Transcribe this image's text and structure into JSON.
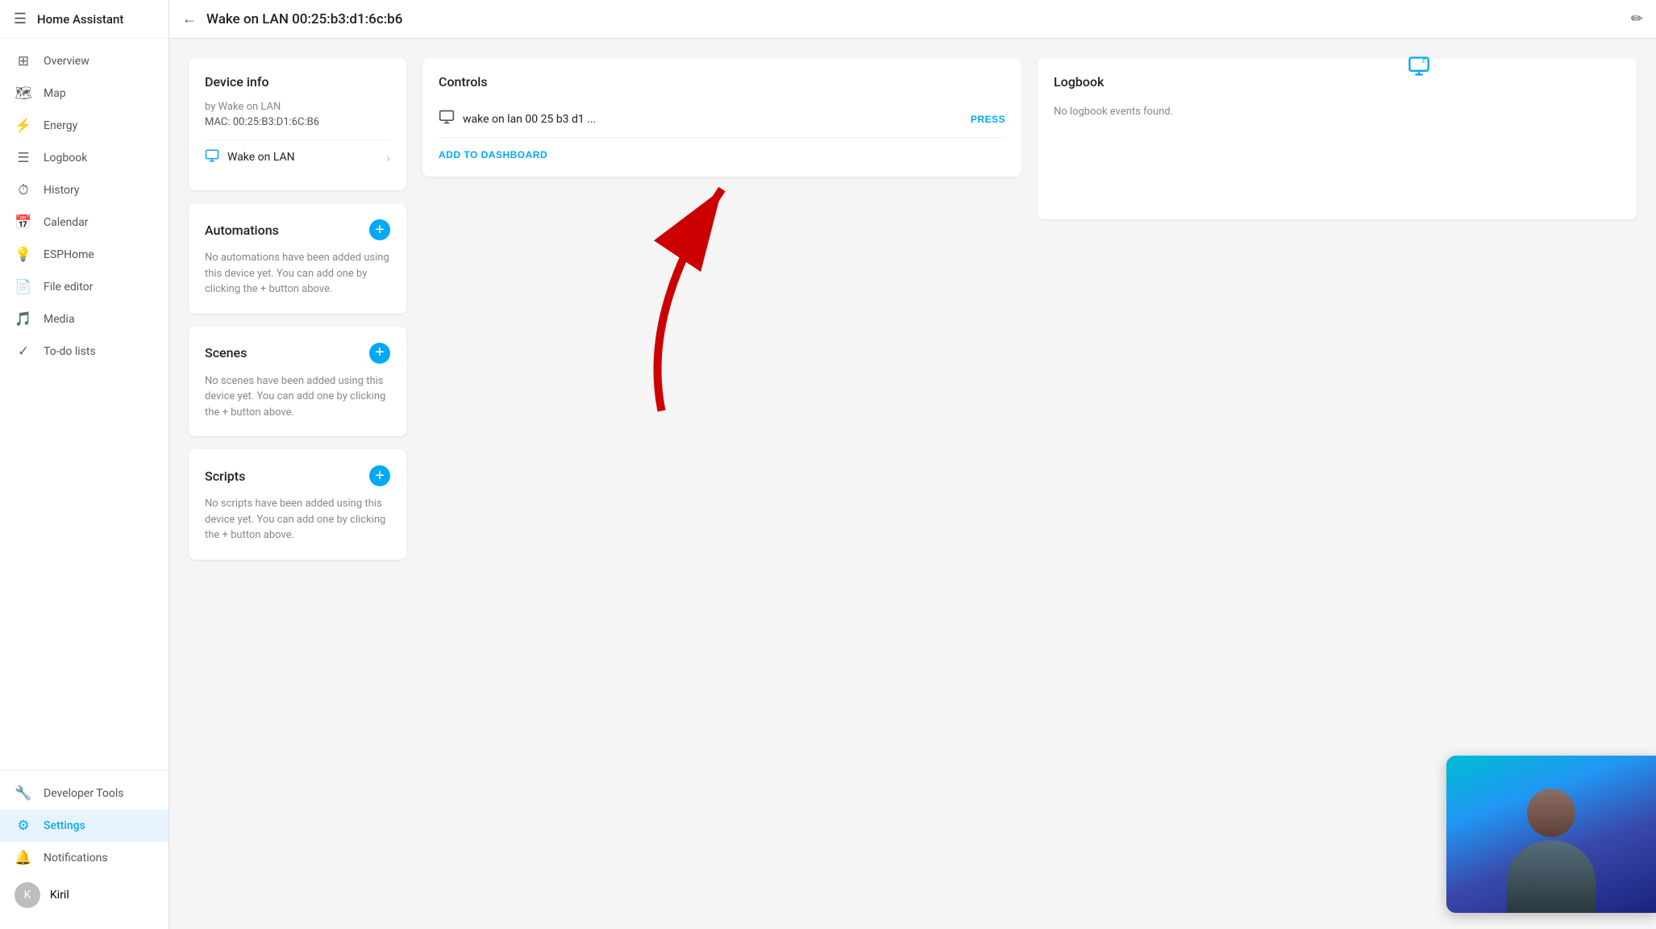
{
  "app": {
    "title": "Home Assistant"
  },
  "topbar": {
    "title": "Wake on LAN 00:25:b3:d1:6c:b6",
    "back_label": "←",
    "edit_label": "✏"
  },
  "sidebar": {
    "items": [
      {
        "id": "overview",
        "label": "Overview",
        "icon": "grid"
      },
      {
        "id": "map",
        "label": "Map",
        "icon": "map"
      },
      {
        "id": "energy",
        "label": "Energy",
        "icon": "bolt"
      },
      {
        "id": "logbook",
        "label": "Logbook",
        "icon": "list"
      },
      {
        "id": "history",
        "label": "History",
        "icon": "history"
      },
      {
        "id": "calendar",
        "label": "Calendar",
        "icon": "calendar"
      },
      {
        "id": "esphome",
        "label": "ESPHome",
        "icon": "chip"
      },
      {
        "id": "file-editor",
        "label": "File editor",
        "icon": "file"
      },
      {
        "id": "media",
        "label": "Media",
        "icon": "music"
      },
      {
        "id": "todo",
        "label": "To-do lists",
        "icon": "check"
      }
    ],
    "bottom": [
      {
        "id": "developer-tools",
        "label": "Developer Tools",
        "icon": "wrench"
      },
      {
        "id": "settings",
        "label": "Settings",
        "icon": "gear",
        "active": true
      }
    ],
    "notifications_label": "Notifications",
    "user_label": "Kiril"
  },
  "device_info": {
    "card_title": "Device info",
    "by_label": "by Wake on LAN",
    "mac_label": "MAC: 00:25:B3:D1:6C:B6",
    "link_label": "Wake on LAN"
  },
  "controls": {
    "card_title": "Controls",
    "item_label": "wake on lan 00 25 b3 d1 ...",
    "press_label": "PRESS",
    "add_to_dashboard_label": "ADD TO DASHBOARD"
  },
  "automations": {
    "card_title": "Automations",
    "empty_text": "No automations have been added using this device yet. You can add one by clicking the + button above."
  },
  "scenes": {
    "card_title": "Scenes",
    "empty_text": "No scenes have been added using this device yet. You can add one by clicking the + button above."
  },
  "scripts": {
    "card_title": "Scripts",
    "empty_text": "No scripts have been added using this device yet. You can add one by clicking the + button above."
  },
  "logbook": {
    "card_title": "Logbook",
    "empty_text": "No logbook events found."
  }
}
